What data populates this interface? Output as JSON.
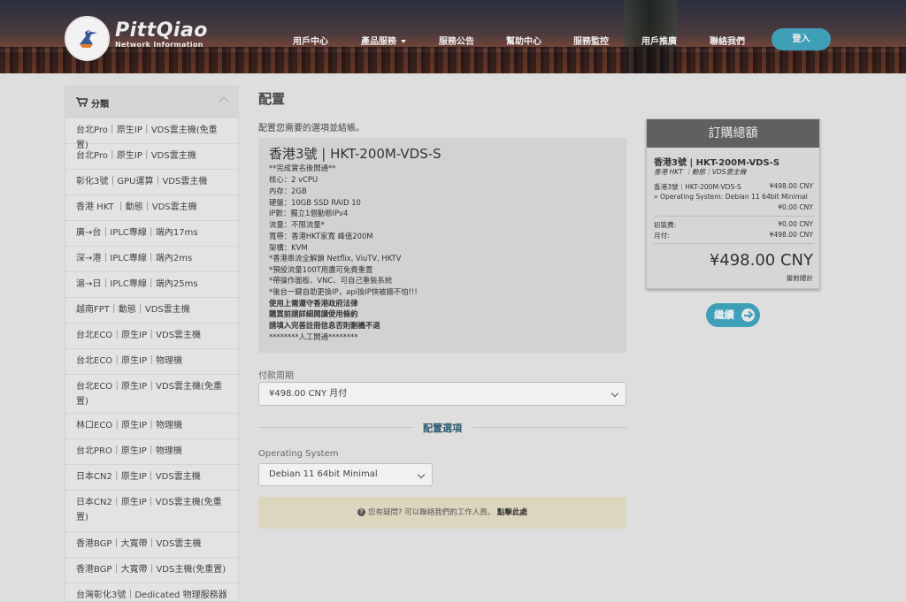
{
  "header": {
    "brand_name": "PittQiao",
    "brand_sub": "Network Information",
    "nav": [
      "用戶中心",
      "產品服務",
      "服務公告",
      "幫助中心",
      "服務監控",
      "用戶推廣",
      "聯絡我們"
    ],
    "login_label": "登入"
  },
  "sidebar": {
    "title": "分類",
    "items": [
      "台北Pro｜原生IP｜VDS雲主機(免重置)",
      "台北Pro｜原生IP｜VDS雲主機",
      "彰化3號｜GPU運算｜VDS雲主機",
      "香港 HKT ｜動態｜VDS雲主機",
      "廣→台｜IPLC專線｜端內17ms",
      "深→港｜IPLC專線｜端內2ms",
      "滬→日｜IPLC專線｜端內25ms",
      "越南FPT｜動態｜VDS雲主機",
      "台北ECO｜原生IP｜VDS雲主機",
      "台北ECO｜原生IP｜物理機",
      "台北ECO｜原生IP｜VDS雲主機(免重置)",
      "林口ECO｜原生IP｜物理機",
      "台北PRO｜原生IP｜物理機",
      "日本CN2｜原生IP｜VDS雲主機",
      "日本CN2｜原生IP｜VDS雲主機(免重置)",
      "香港BGP｜大寬帶｜VDS雲主機",
      "香港BGP｜大寬帶｜VDS主機(免重置)",
      "台灣彰化3號｜Dedicated 物理服務器"
    ]
  },
  "main": {
    "title": "配置",
    "intro": "配置您需要的選項並結帳。",
    "product_name": "香港3號 | HKT-200M-VDS-S",
    "description": [
      "**完成實名後開通**",
      "核心：2 vCPU",
      "內存：2GB",
      "硬盤：10GB SSD RAID 10",
      "IP數：獨立1個動態IPv4",
      "流量：不限流量*",
      "寬帶：香港HKT家寬 峰值200M",
      "架構：KVM",
      "*香港串流全解鎖 Netflix, ViuTV, HKTV",
      "*預設流量100T用盡可免費重置",
      "*帶操作面板、VNC、可自己重裝系統",
      "*後台一鍵自助更換IP，api換IP快被牆不怕!!!",
      "使用上需遵守香港政府法律",
      "購買前請詳細閱讀使用條約",
      "請填入完善註冊信息否則刪機不退",
      "********人工開通********"
    ],
    "billing_label": "付款周期",
    "billing_value": "¥498.00 CNY 月付",
    "config_section": "配置選項",
    "os_label": "Operating System",
    "os_value": "Debian 11 64bit Minimal",
    "help_text": "您有疑問? 可以聯絡我們的工作人員。",
    "help_link": "點擊此處"
  },
  "summary": {
    "title": "訂購總額",
    "product": "香港3號 | HKT-200M-VDS-S",
    "group": "香港 HKT ｜動態｜VDS雲主機",
    "line_item_name": "香港3號｜HKT-200M-VDS-S",
    "line_item_price": "¥498.00 CNY",
    "os_option": "» Operating System: Debian 11 64bit Minimal",
    "os_price": "¥0.00 CNY",
    "setup_label": "初裝費:",
    "setup_price": "¥0.00 CNY",
    "monthly_label": "月付:",
    "monthly_price": "¥498.00 CNY",
    "total": "¥498.00 CNY",
    "total_label": "當前總計"
  },
  "continue_label": "繼續"
}
